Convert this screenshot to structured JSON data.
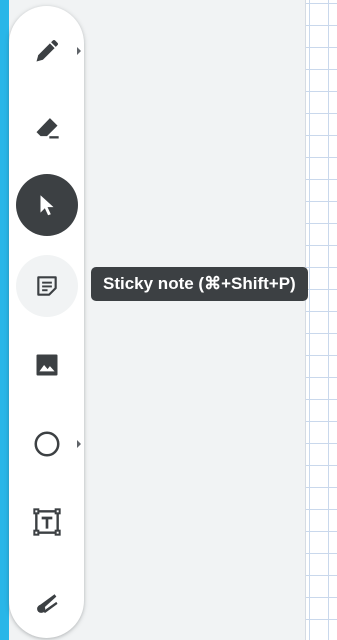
{
  "toolbar": {
    "tools": [
      {
        "name": "pen",
        "icon": "pen-icon",
        "has_submenu": true
      },
      {
        "name": "eraser",
        "icon": "eraser-icon",
        "has_submenu": false
      },
      {
        "name": "select",
        "icon": "cursor-icon",
        "active": true
      },
      {
        "name": "sticky-note",
        "icon": "sticky-note-icon",
        "hover": true
      },
      {
        "name": "image",
        "icon": "image-icon"
      },
      {
        "name": "shape",
        "icon": "circle-icon",
        "has_submenu": true
      },
      {
        "name": "text-box",
        "icon": "text-box-icon"
      },
      {
        "name": "laser",
        "icon": "laser-icon"
      }
    ]
  },
  "tooltip": {
    "text": "Sticky note (⌘+Shift+P)"
  },
  "colors": {
    "accent_left_edge": "#29b6e8",
    "active_tool_bg": "#3c4043",
    "tooltip_bg": "#3c4043",
    "icon": "#3c4043",
    "canvas_grid": "#c9d8ec"
  }
}
